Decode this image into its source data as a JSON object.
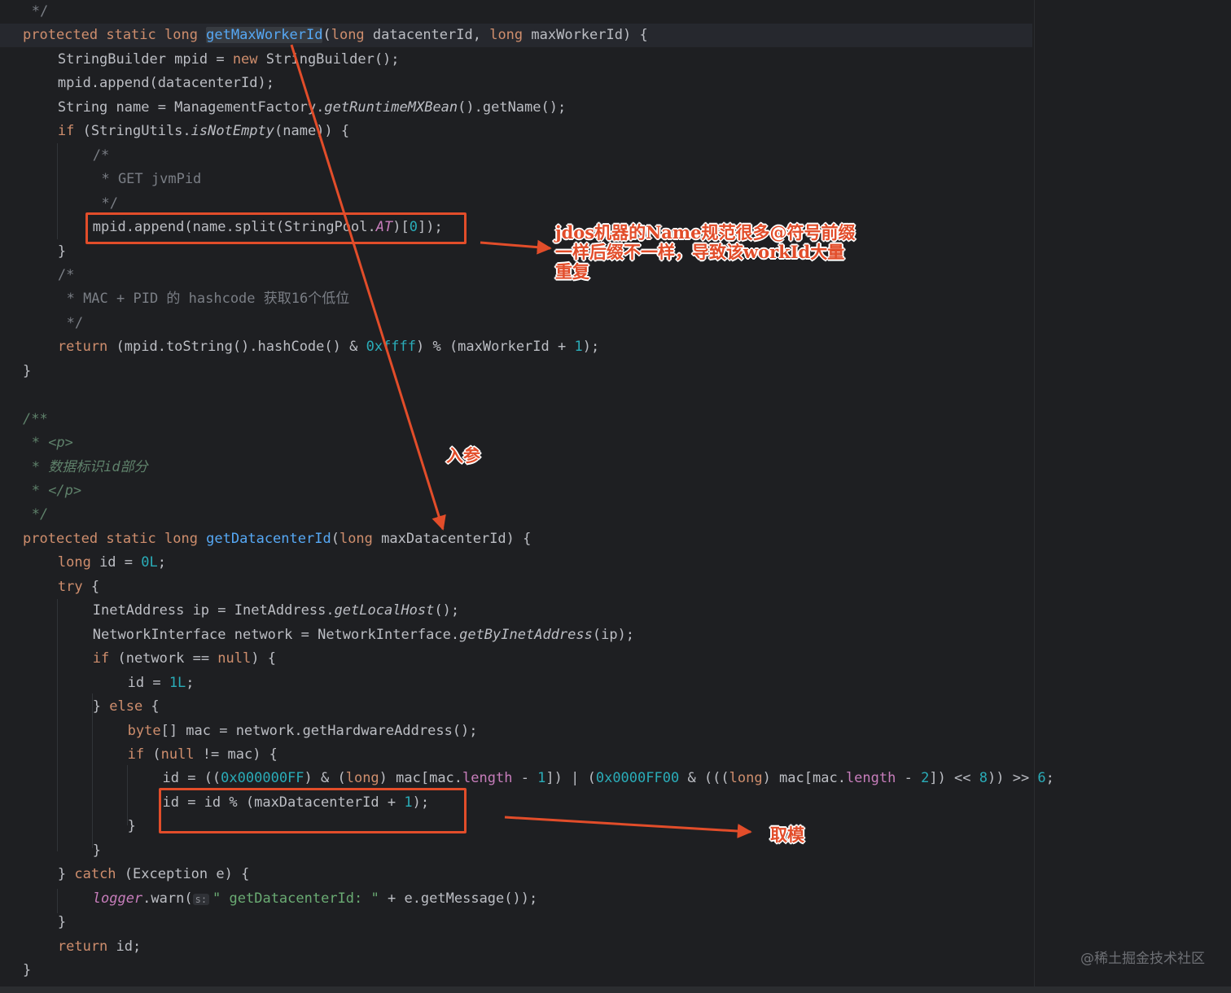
{
  "editor": {
    "lines": [
      {
        "indent": 1,
        "tokens": [
          [
            "com",
            "*/"
          ]
        ]
      },
      {
        "indent": 0,
        "current": true,
        "tokens": [
          [
            "kw",
            "protected static long "
          ],
          [
            "fn hl",
            "getMaxWorkerId"
          ],
          [
            "",
            "("
          ],
          [
            "kw",
            "long "
          ],
          [
            "",
            "datacenterId, "
          ],
          [
            "kw",
            "long "
          ],
          [
            "",
            "maxWorkerId) {"
          ]
        ]
      },
      {
        "indent": 4,
        "tokens": [
          [
            "",
            "StringBuilder mpid = "
          ],
          [
            "kw",
            "new "
          ],
          [
            "",
            "StringBuilder();"
          ]
        ]
      },
      {
        "indent": 4,
        "tokens": [
          [
            "",
            "mpid.append(datacenterId);"
          ]
        ]
      },
      {
        "indent": 4,
        "tokens": [
          [
            "",
            "String name = ManagementFactory."
          ],
          [
            "it",
            "getRuntimeMXBean"
          ],
          [
            "",
            "().getName();"
          ]
        ]
      },
      {
        "indent": 4,
        "tokens": [
          [
            "kw",
            "if "
          ],
          [
            "",
            "(StringUtils."
          ],
          [
            "it",
            "isNotEmpty"
          ],
          [
            "",
            "(name)) {"
          ]
        ]
      },
      {
        "indent": 8,
        "tokens": [
          [
            "com",
            "/*"
          ]
        ]
      },
      {
        "indent": 9,
        "tokens": [
          [
            "com",
            "* GET jvmPid"
          ]
        ]
      },
      {
        "indent": 9,
        "tokens": [
          [
            "com",
            "*/"
          ]
        ]
      },
      {
        "indent": 8,
        "tokens": [
          [
            "",
            "mpid.append(name.split(StringPool."
          ],
          [
            "fld it",
            "AT"
          ],
          [
            "",
            ")["
          ],
          [
            "num",
            "0"
          ],
          [
            "",
            "]);"
          ]
        ]
      },
      {
        "indent": 4,
        "tokens": [
          [
            "",
            "}"
          ]
        ]
      },
      {
        "indent": 4,
        "tokens": [
          [
            "com",
            "/*"
          ]
        ]
      },
      {
        "indent": 5,
        "tokens": [
          [
            "com",
            "* MAC + PID 的 hashcode 获取16个低位"
          ]
        ]
      },
      {
        "indent": 5,
        "tokens": [
          [
            "com",
            "*/"
          ]
        ]
      },
      {
        "indent": 4,
        "tokens": [
          [
            "kw",
            "return "
          ],
          [
            "",
            "(mpid.toString().hashCode() & "
          ],
          [
            "num",
            "0xffff"
          ],
          [
            "",
            ") % (maxWorkerId + "
          ],
          [
            "num",
            "1"
          ],
          [
            "",
            ");"
          ]
        ]
      },
      {
        "indent": 0,
        "tokens": [
          [
            "",
            "}"
          ]
        ]
      },
      {
        "indent": 0,
        "tokens": []
      },
      {
        "indent": 0,
        "tokens": [
          [
            "doc",
            "/**"
          ]
        ]
      },
      {
        "indent": 1,
        "tokens": [
          [
            "doc",
            "* <p>"
          ]
        ]
      },
      {
        "indent": 1,
        "tokens": [
          [
            "doc",
            "* 数据标识id部分"
          ]
        ]
      },
      {
        "indent": 1,
        "tokens": [
          [
            "doc",
            "* </p>"
          ]
        ]
      },
      {
        "indent": 1,
        "tokens": [
          [
            "doc",
            "*/"
          ]
        ]
      },
      {
        "indent": 0,
        "tokens": [
          [
            "kw",
            "protected static long "
          ],
          [
            "fn",
            "getDatacenterId"
          ],
          [
            "",
            "("
          ],
          [
            "kw",
            "long "
          ],
          [
            "",
            "maxDatacenterId) {"
          ]
        ]
      },
      {
        "indent": 4,
        "tokens": [
          [
            "kw",
            "long "
          ],
          [
            "",
            "id = "
          ],
          [
            "num",
            "0L"
          ],
          [
            "",
            ";"
          ]
        ]
      },
      {
        "indent": 4,
        "tokens": [
          [
            "kw",
            "try "
          ],
          [
            "",
            "{"
          ]
        ]
      },
      {
        "indent": 8,
        "tokens": [
          [
            "",
            "InetAddress ip = InetAddress."
          ],
          [
            "it",
            "getLocalHost"
          ],
          [
            "",
            "();"
          ]
        ]
      },
      {
        "indent": 8,
        "tokens": [
          [
            "",
            "NetworkInterface network = NetworkInterface."
          ],
          [
            "it",
            "getByInetAddress"
          ],
          [
            "",
            "(ip);"
          ]
        ]
      },
      {
        "indent": 8,
        "tokens": [
          [
            "kw",
            "if "
          ],
          [
            "",
            "(network == "
          ],
          [
            "kw",
            "null"
          ],
          [
            "",
            ") {"
          ]
        ]
      },
      {
        "indent": 12,
        "tokens": [
          [
            "",
            "id = "
          ],
          [
            "num",
            "1L"
          ],
          [
            "",
            ";"
          ]
        ]
      },
      {
        "indent": 8,
        "tokens": [
          [
            "",
            "} "
          ],
          [
            "kw",
            "else "
          ],
          [
            "",
            "{"
          ]
        ]
      },
      {
        "indent": 12,
        "tokens": [
          [
            "kw",
            "byte"
          ],
          [
            "",
            "[] mac = network.getHardwareAddress();"
          ]
        ]
      },
      {
        "indent": 12,
        "tokens": [
          [
            "kw",
            "if "
          ],
          [
            "",
            "("
          ],
          [
            "kw",
            "null "
          ],
          [
            "",
            "!= mac) {"
          ]
        ]
      },
      {
        "indent": 16,
        "tokens": [
          [
            "",
            "id = (("
          ],
          [
            "num",
            "0x000000FF"
          ],
          [
            "",
            ") & ("
          ],
          [
            "kw",
            "long"
          ],
          [
            "",
            ") mac[mac."
          ],
          [
            "fld",
            "length"
          ],
          [
            "",
            " - "
          ],
          [
            "num",
            "1"
          ],
          [
            "",
            "]) | ("
          ],
          [
            "num",
            "0x0000FF00"
          ],
          [
            "",
            " & ((("
          ],
          [
            "kw",
            "long"
          ],
          [
            "",
            ") mac[mac."
          ],
          [
            "fld",
            "length"
          ],
          [
            "",
            " - "
          ],
          [
            "num",
            "2"
          ],
          [
            "",
            "]) << "
          ],
          [
            "num",
            "8"
          ],
          [
            "",
            ")) >> "
          ],
          [
            "num",
            "6"
          ],
          [
            "",
            ";"
          ]
        ]
      },
      {
        "indent": 16,
        "tokens": [
          [
            "",
            "id = id % (maxDatacenterId + "
          ],
          [
            "num",
            "1"
          ],
          [
            "",
            ");"
          ]
        ]
      },
      {
        "indent": 12,
        "tokens": [
          [
            "",
            "}"
          ]
        ]
      },
      {
        "indent": 8,
        "tokens": [
          [
            "",
            "}"
          ]
        ]
      },
      {
        "indent": 4,
        "tokens": [
          [
            "",
            "} "
          ],
          [
            "kw",
            "catch "
          ],
          [
            "",
            "(Exception e) {"
          ]
        ]
      },
      {
        "indent": 8,
        "tokens": [
          [
            "fld it",
            "logger"
          ],
          [
            "",
            ".warn("
          ],
          [
            "hint",
            "s:"
          ],
          [
            "str",
            "\" getDatacenterId: \""
          ],
          [
            "",
            " + e.getMessage());"
          ]
        ]
      },
      {
        "indent": 4,
        "tokens": [
          [
            "",
            "}"
          ]
        ]
      },
      {
        "indent": 4,
        "tokens": [
          [
            "kw",
            "return "
          ],
          [
            "",
            "id;"
          ]
        ]
      },
      {
        "indent": 0,
        "tokens": [
          [
            "",
            "}"
          ]
        ]
      }
    ]
  },
  "annotations": {
    "note_duplicate": [
      "jdos机器的Name规范很多@符号前缀",
      "一样后缀不一样，导致该workId大量",
      "重复"
    ],
    "note_param": "入参",
    "note_modulo": "取模",
    "accent_color": "#e24d2a"
  },
  "watermark": "@稀土掘金技术社区",
  "theme": {
    "background": "#1e1f22",
    "keyword": "#cf8e6d",
    "function": "#56a8f5",
    "number": "#2aacb8",
    "comment": "#7a7e85",
    "string": "#6aab73"
  }
}
